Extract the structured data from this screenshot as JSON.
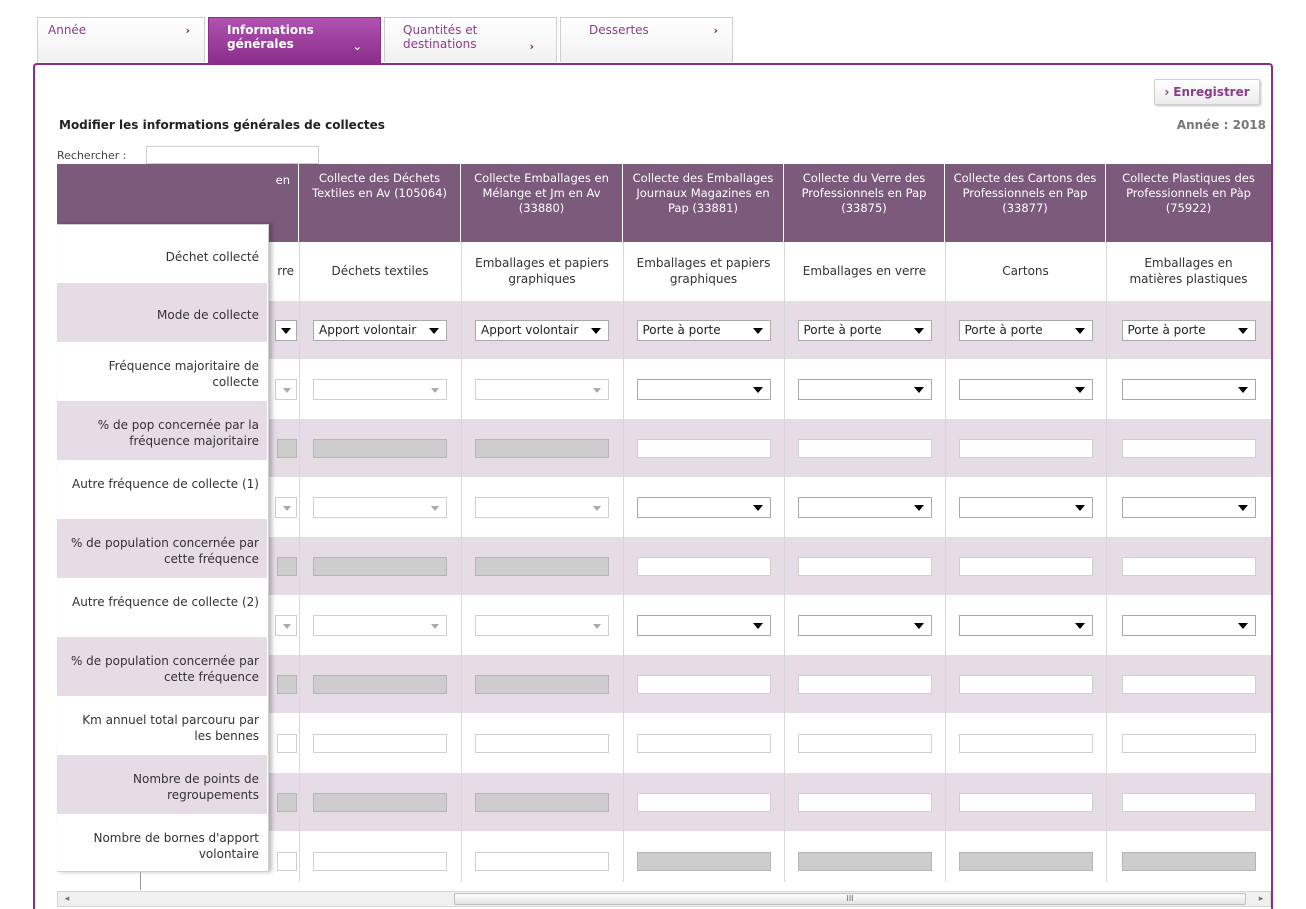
{
  "tabs": [
    {
      "label": "Année",
      "arrow": "›"
    },
    {
      "label": "Informations générales",
      "arrow": "⌄"
    },
    {
      "label": "Quantités et destinations",
      "arrow": "›"
    },
    {
      "label": "Dessertes",
      "arrow": "›"
    }
  ],
  "toolbar": {
    "save_label": "Enregistrer",
    "save_arrow": "›"
  },
  "page_title": "Modifier les informations générales de collectes",
  "year_label": "Année : 2018",
  "search": {
    "label": "Rechercher :",
    "value": ""
  },
  "columns": [
    {
      "header": "en",
      "waste": "rre"
    },
    {
      "header": "Collecte des Déchets Textiles en Av (105064)",
      "waste": "Déchets textiles",
      "mode": "Apport volontair"
    },
    {
      "header": "Collecte Emballages en Mélange et Jm en Av (33880)",
      "waste": "Emballages et papiers graphiques",
      "mode": "Apport volontair"
    },
    {
      "header": "Collecte des Emballages Journaux Magazines en Pap (33881)",
      "waste": "Emballages et papiers graphiques",
      "mode": "Porte à porte"
    },
    {
      "header": "Collecte du Verre des Professionnels en Pap (33875)",
      "waste": "Emballages en verre",
      "mode": "Porte à porte"
    },
    {
      "header": "Collecte des Cartons des Professionnels en Pap (33877)",
      "waste": "Cartons",
      "mode": "Porte à porte"
    },
    {
      "header": "Collecte Plastiques des Professionnels en Pàp (75922)",
      "waste": "Emballages en matières plastiques",
      "mode": "Porte à porte"
    }
  ],
  "row_labels": [
    "Déchet collecté",
    "Mode de collecte",
    "Fréquence majoritaire de collecte",
    "% de pop concernée par la fréquence majoritaire",
    "Autre fréquence de collecte (1)",
    "% de population concernée par cette fréquence",
    "Autre fréquence de collecte (2)",
    "% de population concernée par cette fréquence",
    "Km annuel total parcouru par les bennes",
    "Nombre de points de regroupements",
    "Nombre de bornes d'apport volontaire"
  ],
  "scrollbar": {
    "left_arrow": "◂",
    "right_arrow": "▸",
    "grip": "III"
  }
}
